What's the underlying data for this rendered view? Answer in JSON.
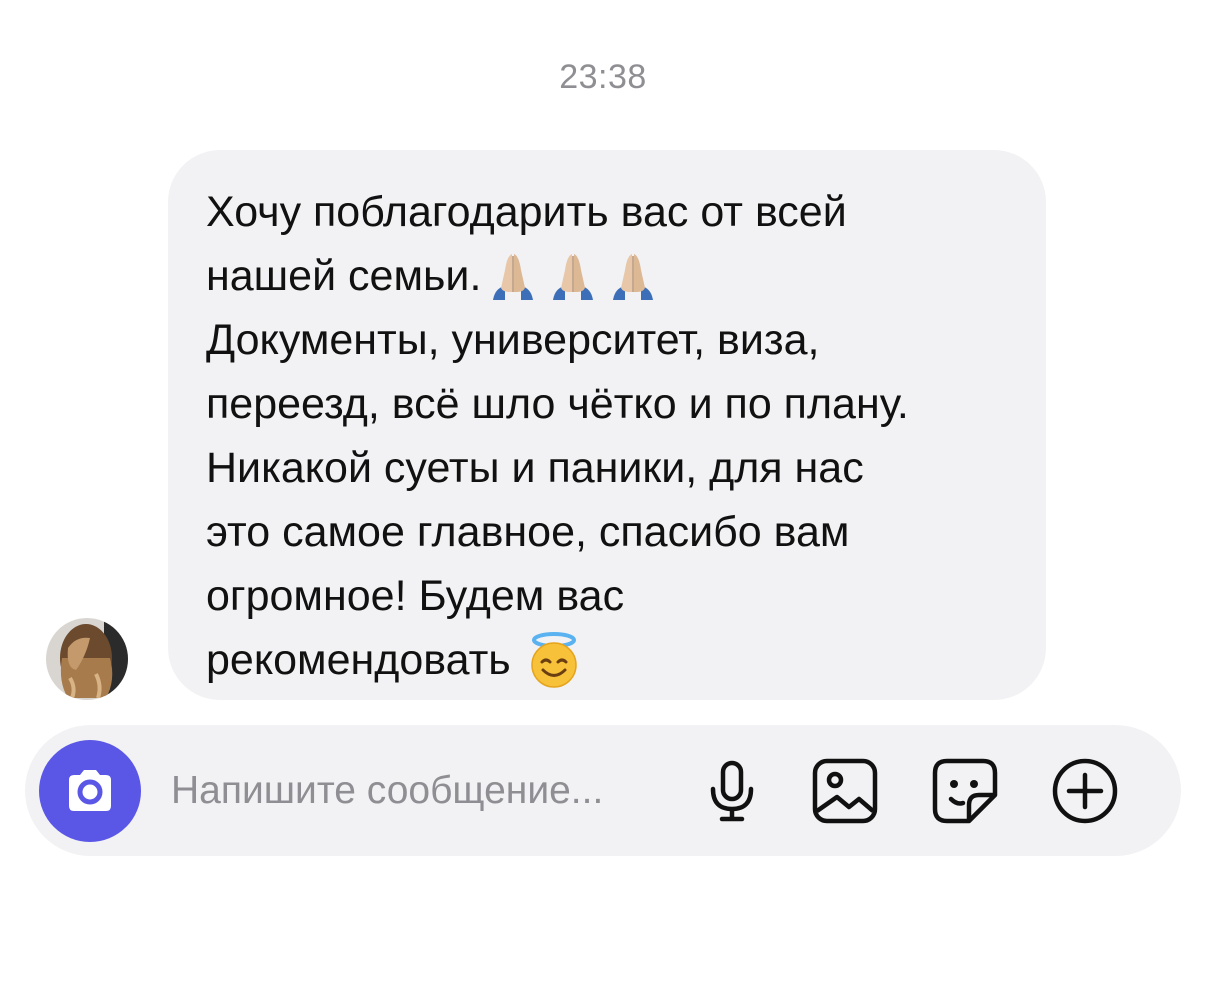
{
  "chat": {
    "timestamp": "23:38",
    "message": {
      "lines": [
        "Хочу поблагодарить вас от всей",
        "нашей семьи.",
        "Документы, университет, виза,",
        "переезд, всё шло чётко и по плану.",
        "Никакой суеты и паники, для нас",
        "это самое главное, спасибо вам",
        "огромное! Будем вас",
        "рекомендовать"
      ],
      "emojis": {
        "line2": [
          "folded-hands",
          "folded-hands",
          "folded-hands"
        ],
        "line8": [
          "smiling-face-with-halo"
        ]
      }
    },
    "sender_avatar": "avatar-photo"
  },
  "composer": {
    "placeholder": "Напишите сообщение...",
    "camera_icon": "camera-icon",
    "tools": [
      "microphone-icon",
      "gallery-icon",
      "sticker-icon",
      "plus-circle-icon"
    ],
    "accent_color": "#5b57e6",
    "bubble_color": "#f2f2f4"
  }
}
